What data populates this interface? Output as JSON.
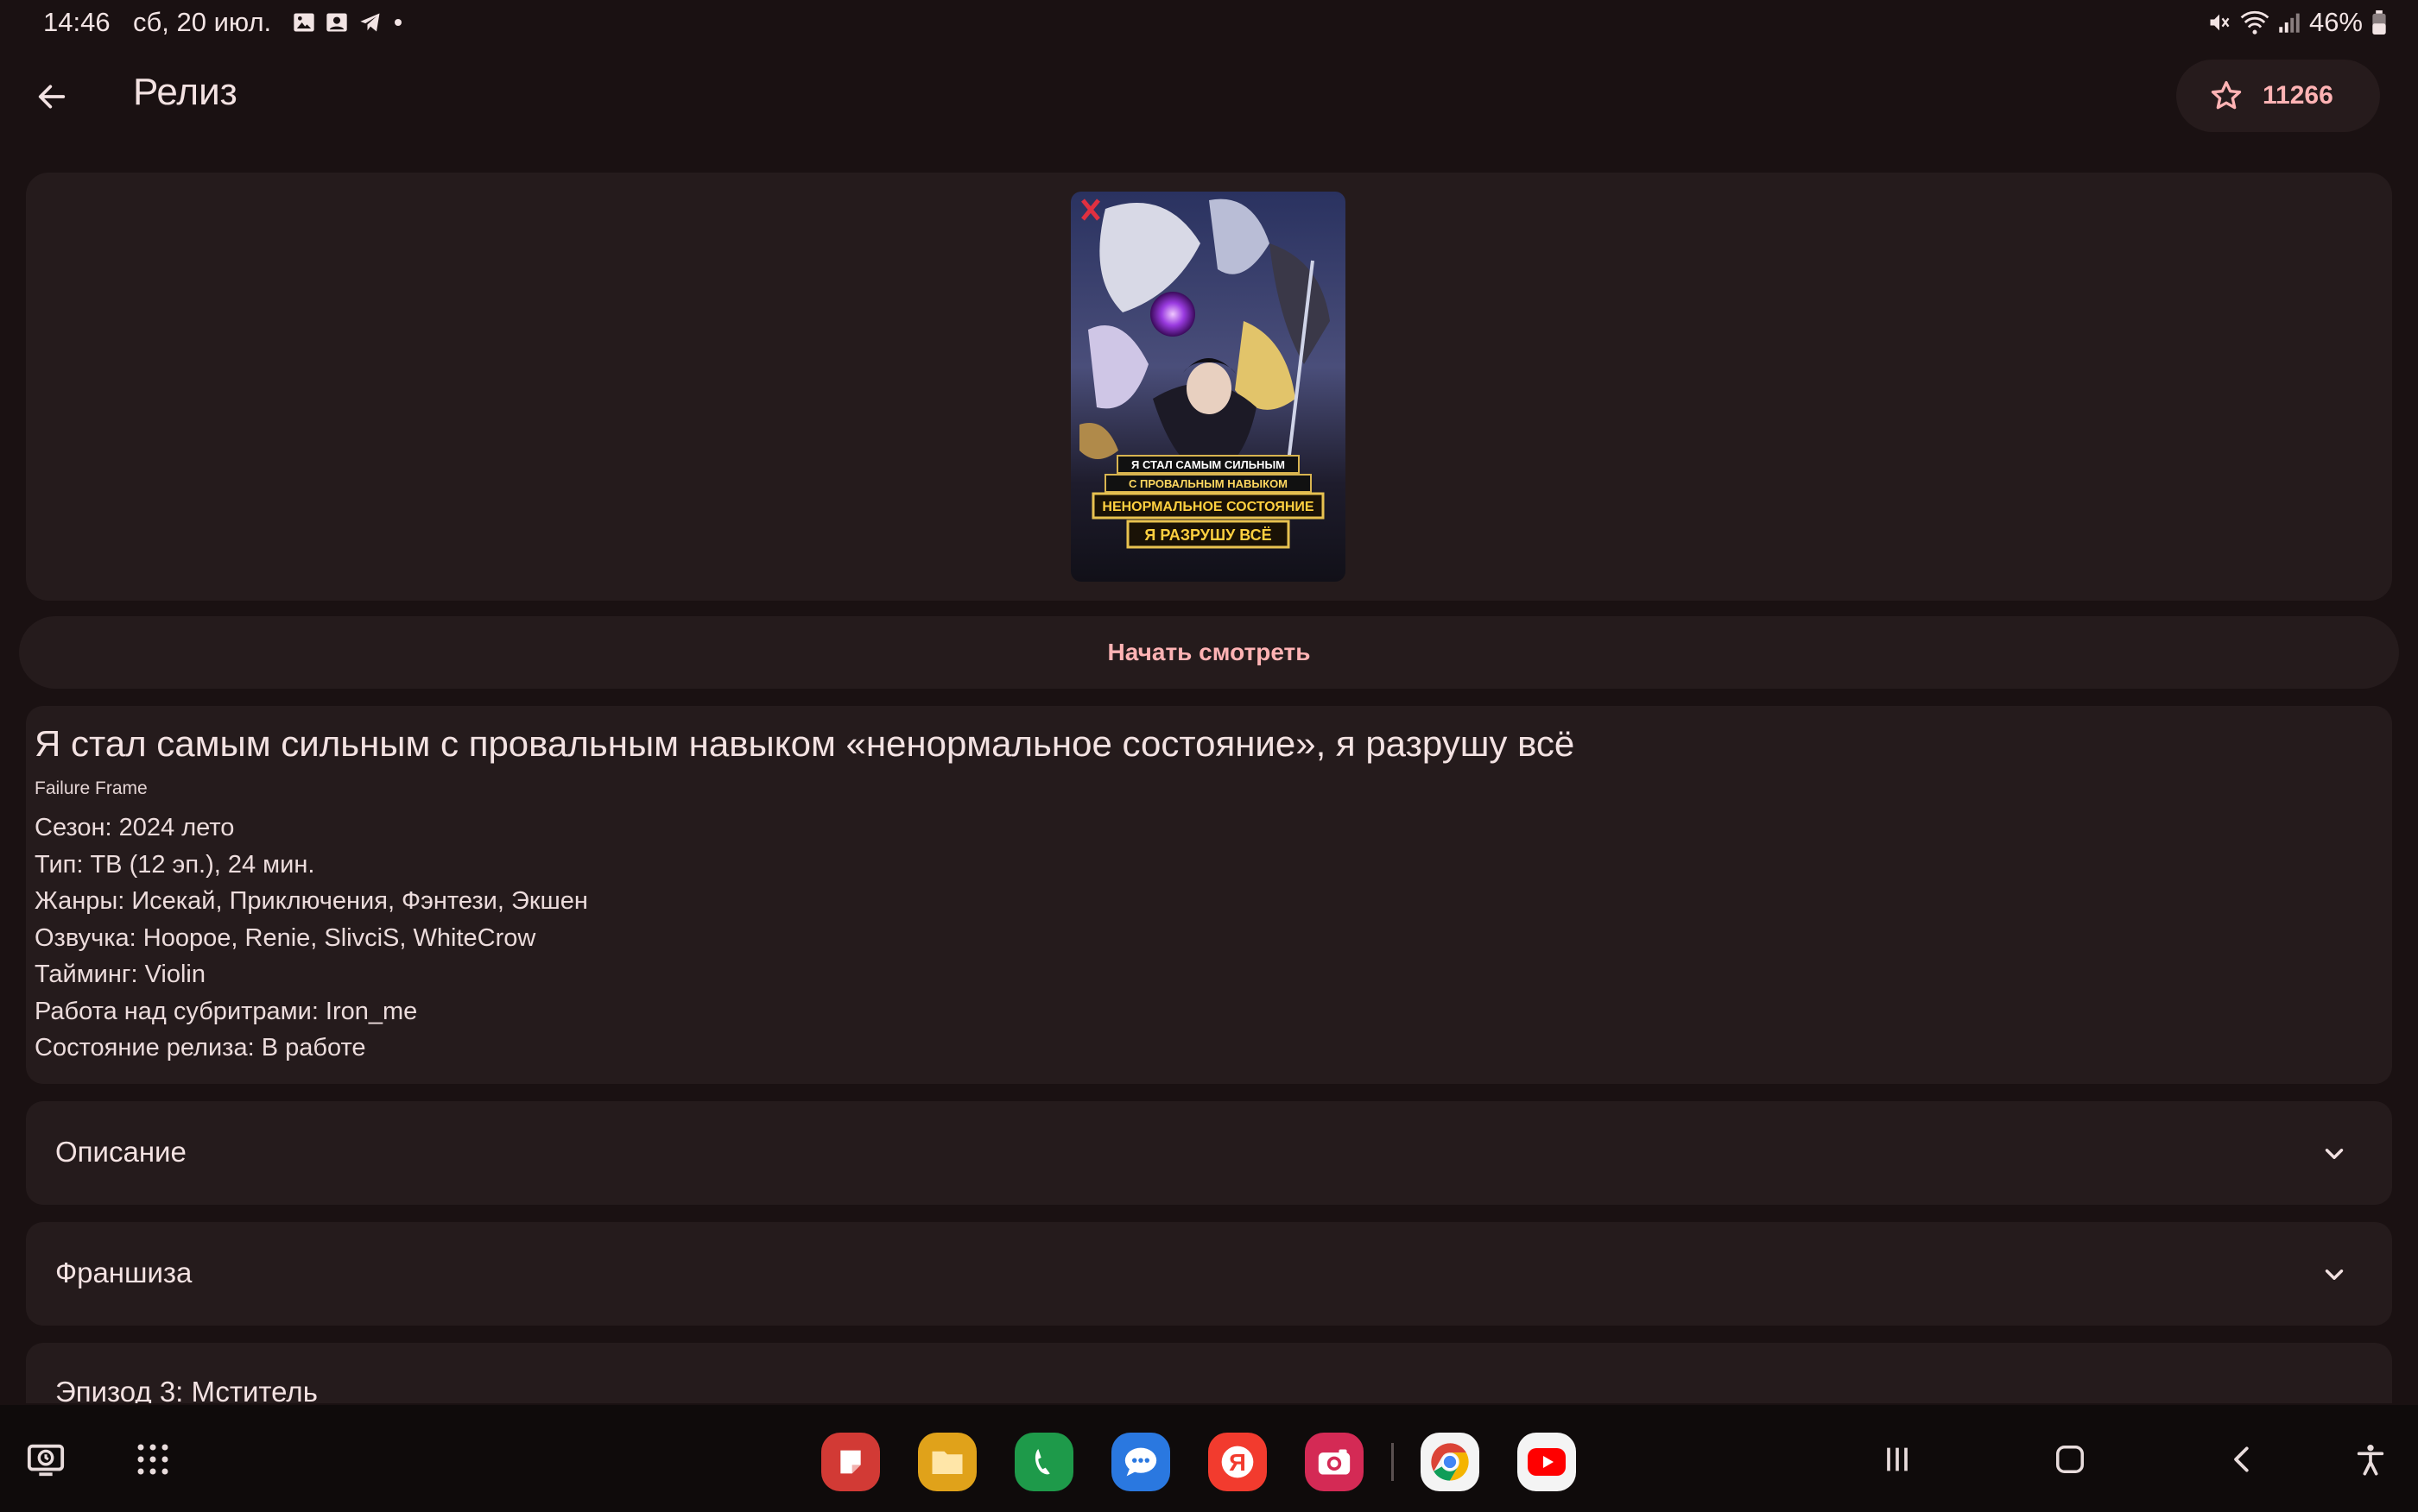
{
  "status_bar": {
    "time": "14:46",
    "date": "сб, 20 июл.",
    "battery": "46%"
  },
  "app_bar": {
    "title": "Релиз",
    "favorites_count": "11266"
  },
  "poster": {
    "lines": [
      "Я СТАЛ САМЫМ СИЛЬНЫМ",
      "С ПРОВАЛЬНЫМ НАВЫКОМ",
      "НЕНОРМАЛЬНОЕ СОСТОЯНИЕ",
      "Я РАЗРУШУ ВСЁ"
    ]
  },
  "actions": {
    "start_watching": "Начать смотреть"
  },
  "release": {
    "title": "Я стал самым сильным с провальным навыком «ненормальное состояние», я разрушу всё",
    "original_title": "Failure Frame",
    "info": [
      "Сезон: 2024 лето",
      "Тип: ТВ (12 эп.), 24 мин.",
      "Жанры: Исекай, Приключения, Фэнтези, Экшен",
      "Озвучка: Hoopoe, Renie, SlivciS, WhiteCrow",
      "Тайминг: Violin",
      "Работа над субритрами: Iron_me",
      "Состояние релиза: В работе"
    ]
  },
  "sections": {
    "description": "Описание",
    "franchise": "Франшиза",
    "episode": "Эпизод 3: Мститель"
  },
  "colors": {
    "background": "#1a1112",
    "card": "#251b1c",
    "accent": "#ffb3b4"
  },
  "taskbar": {
    "apps": [
      "notes-app",
      "files-app",
      "phone-app",
      "messages-app",
      "yandex-app",
      "camera-app",
      "chrome-app",
      "youtube-app"
    ]
  }
}
